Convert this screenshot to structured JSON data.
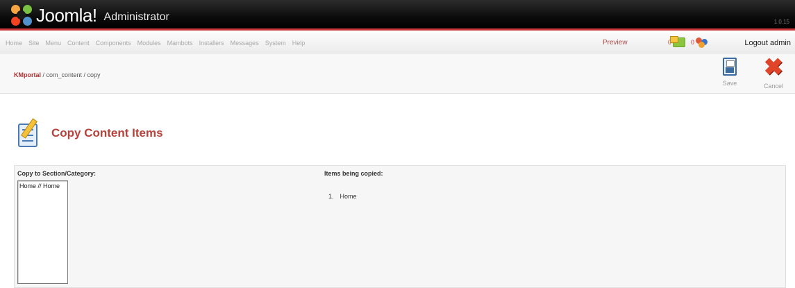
{
  "header": {
    "logo_text": "Joomla!",
    "logo_sub": "Administrator",
    "version": "1.0.15"
  },
  "menu": {
    "items": [
      "Home",
      "Site",
      "Menu",
      "Content",
      "Components",
      "Modules",
      "Mambots",
      "Installers",
      "Messages",
      "System",
      "Help"
    ],
    "preview": "Preview",
    "messages_count": "0",
    "users_count": "0",
    "logout": "Logout admin"
  },
  "breadcrumb": {
    "home": "KMportal",
    "rest": " / com_content / copy"
  },
  "toolbar": {
    "save_label": "Save",
    "cancel_label": "Cancel"
  },
  "page": {
    "title": "Copy Content Items"
  },
  "form": {
    "copy_label": "Copy to Section/Category:",
    "select_options": [
      "Home // Home"
    ],
    "items_label": "Items being copied:",
    "items": [
      {
        "num": "1.",
        "name": "Home"
      }
    ]
  },
  "colors": {
    "accent_red": "#b5423a",
    "header_bar": "#000000",
    "header_stripe": "#c8333a"
  }
}
